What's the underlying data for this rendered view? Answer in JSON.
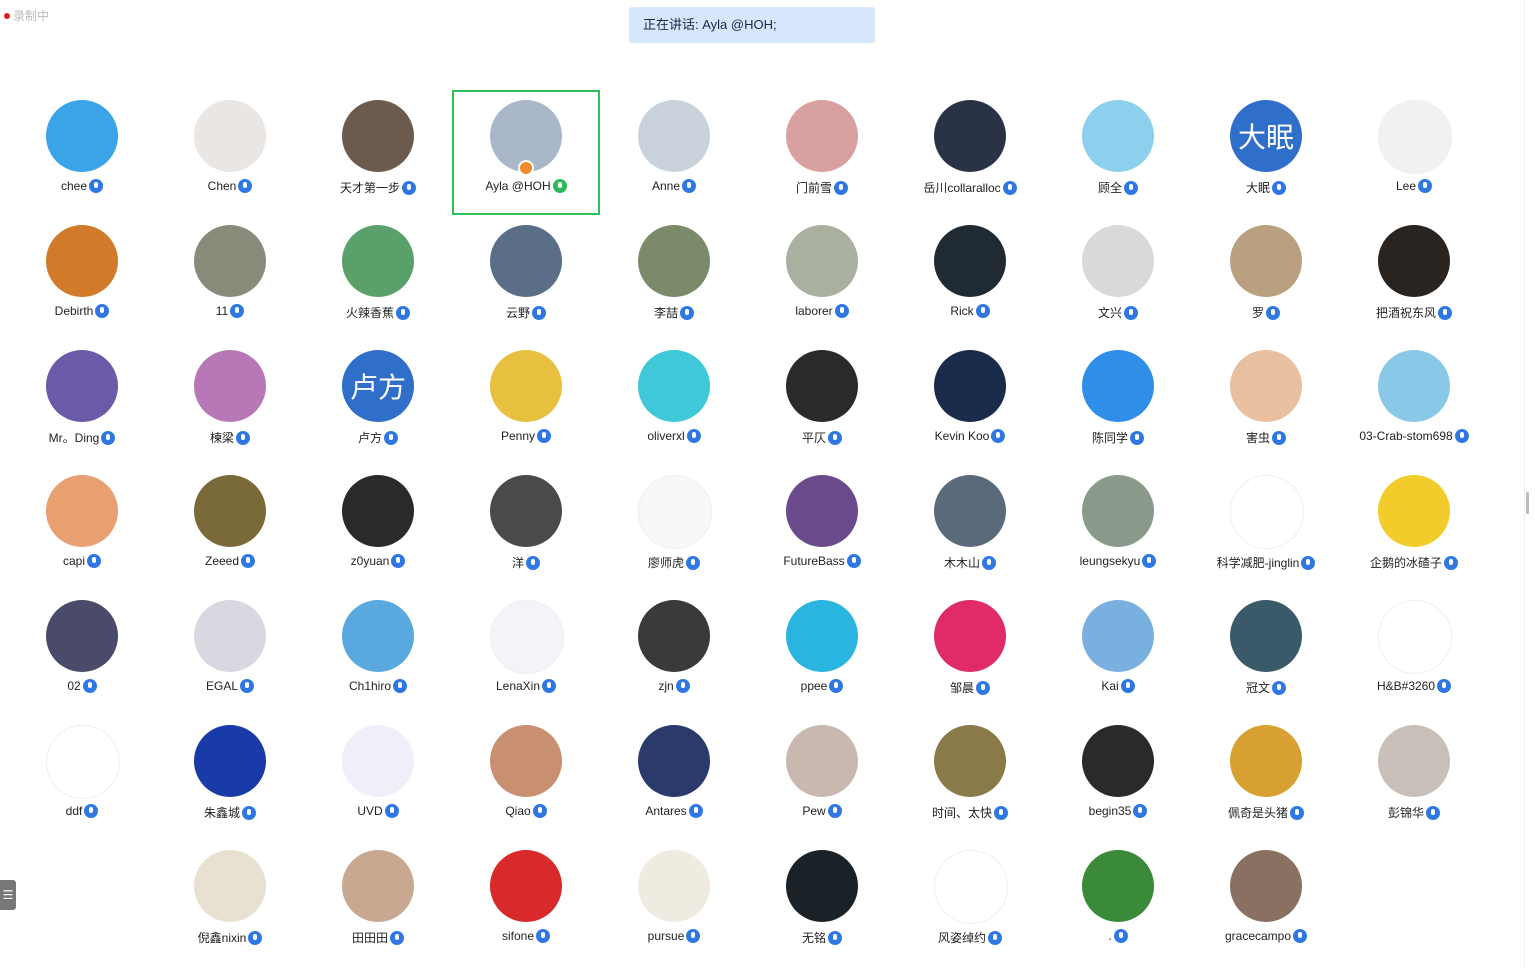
{
  "recording": {
    "label": "录制中"
  },
  "speaking": {
    "text": "正在讲话: Ayla @HOH;"
  },
  "side_tab": {
    "glyph": "☰"
  },
  "participants": [
    {
      "name": "chee",
      "color": "#3aa4e8",
      "initial": "",
      "active": false
    },
    {
      "name": "Chen",
      "color": "#e9e6e3",
      "initial": "",
      "active": false
    },
    {
      "name": "天才第一步",
      "color": "#6b5a4e",
      "initial": "",
      "active": false
    },
    {
      "name": "Ayla @HOH",
      "color": "#a9b7c8",
      "initial": "",
      "active": true
    },
    {
      "name": "Anne",
      "color": "#c9d2da",
      "initial": "",
      "active": false
    },
    {
      "name": "门前雪",
      "color": "#d8a0a0",
      "initial": "",
      "active": false
    },
    {
      "name": "岳川collaralloc",
      "color": "#2a3346",
      "initial": "",
      "active": false
    },
    {
      "name": "顾全",
      "color": "#8dd0ee",
      "initial": "",
      "active": false
    },
    {
      "name": "大眠",
      "color": "#2f6fc9",
      "initial": "大眠",
      "active": false
    },
    {
      "name": "Lee",
      "color": "#f1f1f1",
      "initial": "",
      "active": false
    },
    {
      "name": "Debirth",
      "color": "#d07a2a",
      "initial": "",
      "active": false
    },
    {
      "name": "11",
      "color": "#8a8a7a",
      "initial": "",
      "active": false
    },
    {
      "name": "火辣香蕉",
      "color": "#5aa06a",
      "initial": "",
      "active": false
    },
    {
      "name": "云野",
      "color": "#5a6e88",
      "initial": "",
      "active": false
    },
    {
      "name": "李喆",
      "color": "#7a8a6a",
      "initial": "",
      "active": false
    },
    {
      "name": "laborer",
      "color": "#aab0a0",
      "initial": "",
      "active": false
    },
    {
      "name": "Rick",
      "color": "#1f2a33",
      "initial": "",
      "active": false
    },
    {
      "name": "文兴",
      "color": "#d9d9d9",
      "initial": "",
      "active": false
    },
    {
      "name": "罗",
      "color": "#b8a080",
      "initial": "",
      "active": false
    },
    {
      "name": "把酒祝东风",
      "color": "#2a2420",
      "initial": "",
      "active": false
    },
    {
      "name": "Mr。Ding",
      "color": "#6a5aa8",
      "initial": "",
      "active": false
    },
    {
      "name": "楝梁",
      "color": "#b878b8",
      "initial": "",
      "active": false
    },
    {
      "name": "卢方",
      "color": "#2f6fc9",
      "initial": "卢方",
      "active": false
    },
    {
      "name": "Penny",
      "color": "#e8c040",
      "initial": "",
      "active": false
    },
    {
      "name": "oliverxl",
      "color": "#3ec8d8",
      "initial": "",
      "active": false
    },
    {
      "name": "平仄",
      "color": "#2a2a2a",
      "initial": "",
      "active": false
    },
    {
      "name": "Kevin Koo",
      "color": "#1a2a4a",
      "initial": "",
      "active": false
    },
    {
      "name": "陈同学",
      "color": "#2f8ee8",
      "initial": "",
      "active": false
    },
    {
      "name": "害虫",
      "color": "#e8c0a0",
      "initial": "",
      "active": false
    },
    {
      "name": "03-Crab-stom698",
      "color": "#8ac8e8",
      "initial": "",
      "active": false
    },
    {
      "name": "capi",
      "color": "#e8a070",
      "initial": "",
      "active": false
    },
    {
      "name": "Zeeed",
      "color": "#7a6a3a",
      "initial": "",
      "active": false
    },
    {
      "name": "z0yuan",
      "color": "#2a2a2a",
      "initial": "",
      "active": false
    },
    {
      "name": "洋",
      "color": "#4a4a4a",
      "initial": "",
      "active": false
    },
    {
      "name": "廖师虎",
      "color": "#f8f8f8",
      "initial": "",
      "active": false
    },
    {
      "name": "FutureBass",
      "color": "#6a4a8a",
      "initial": "",
      "active": false
    },
    {
      "name": "木木山",
      "color": "#5a6a7a",
      "initial": "",
      "active": false
    },
    {
      "name": "leungsekyu",
      "color": "#8a9a8a",
      "initial": "",
      "active": false
    },
    {
      "name": "科学减肥-jinglin",
      "color": "#ffffff",
      "initial": "",
      "active": false
    },
    {
      "name": "企鹅的冰碴子",
      "color": "#f2cc2a",
      "initial": "",
      "active": false
    },
    {
      "name": "02",
      "color": "#4a4a6a",
      "initial": "",
      "active": false
    },
    {
      "name": "EGAL",
      "color": "#d8d8e0",
      "initial": "",
      "active": false
    },
    {
      "name": "Ch1hiro",
      "color": "#5aa8e0",
      "initial": "",
      "active": false
    },
    {
      "name": "LenaXin",
      "color": "#f4f4f8",
      "initial": "",
      "active": false
    },
    {
      "name": "zjn",
      "color": "#3a3a3a",
      "initial": "",
      "active": false
    },
    {
      "name": "ppee",
      "color": "#2ab4e0",
      "initial": "",
      "active": false
    },
    {
      "name": "邹晨",
      "color": "#e02a6a",
      "initial": "",
      "active": false
    },
    {
      "name": "Kai",
      "color": "#7ab0e0",
      "initial": "",
      "active": false
    },
    {
      "name": "冠文",
      "color": "#3a5a6a",
      "initial": "",
      "active": false
    },
    {
      "name": "H&B#3260",
      "color": "#ffffff",
      "initial": "",
      "active": false
    },
    {
      "name": "ddf",
      "color": "#ffffff",
      "initial": "",
      "active": false
    },
    {
      "name": "朱鑫城",
      "color": "#1a3aa8",
      "initial": "",
      "active": false
    },
    {
      "name": "UVD",
      "color": "#f0eef8",
      "initial": "",
      "active": false
    },
    {
      "name": "Qiao",
      "color": "#c89070",
      "initial": "",
      "active": false
    },
    {
      "name": "Antares",
      "color": "#2a3a6a",
      "initial": "",
      "active": false
    },
    {
      "name": "Pew",
      "color": "#c8b8b0",
      "initial": "",
      "active": false
    },
    {
      "name": "时间、太快",
      "color": "#8a7a4a",
      "initial": "",
      "active": false
    },
    {
      "name": "begin35",
      "color": "#2a2a2a",
      "initial": "",
      "active": false
    },
    {
      "name": "佩奇是头猪",
      "color": "#d8a030",
      "initial": "",
      "active": false
    },
    {
      "name": "彭锦华",
      "color": "#c8c0b8",
      "initial": "",
      "active": false
    },
    {
      "name": "倪鑫nixin",
      "color": "#e8e0d0",
      "initial": "",
      "active": false
    },
    {
      "name": "田田田",
      "color": "#c8a890",
      "initial": "",
      "active": false
    },
    {
      "name": "sifone",
      "color": "#d82a2a",
      "initial": "",
      "active": false
    },
    {
      "name": "pursue",
      "color": "#f0ebe0",
      "initial": "",
      "active": false
    },
    {
      "name": "无铭",
      "color": "#1a2228",
      "initial": "",
      "active": false
    },
    {
      "name": "风姿绰约",
      "color": "#ffffff",
      "initial": "",
      "active": false
    },
    {
      "name": ".",
      "color": "#3a8a3a",
      "initial": "",
      "active": false
    },
    {
      "name": "gracecampo",
      "color": "#8a7060",
      "initial": "",
      "active": false
    }
  ]
}
